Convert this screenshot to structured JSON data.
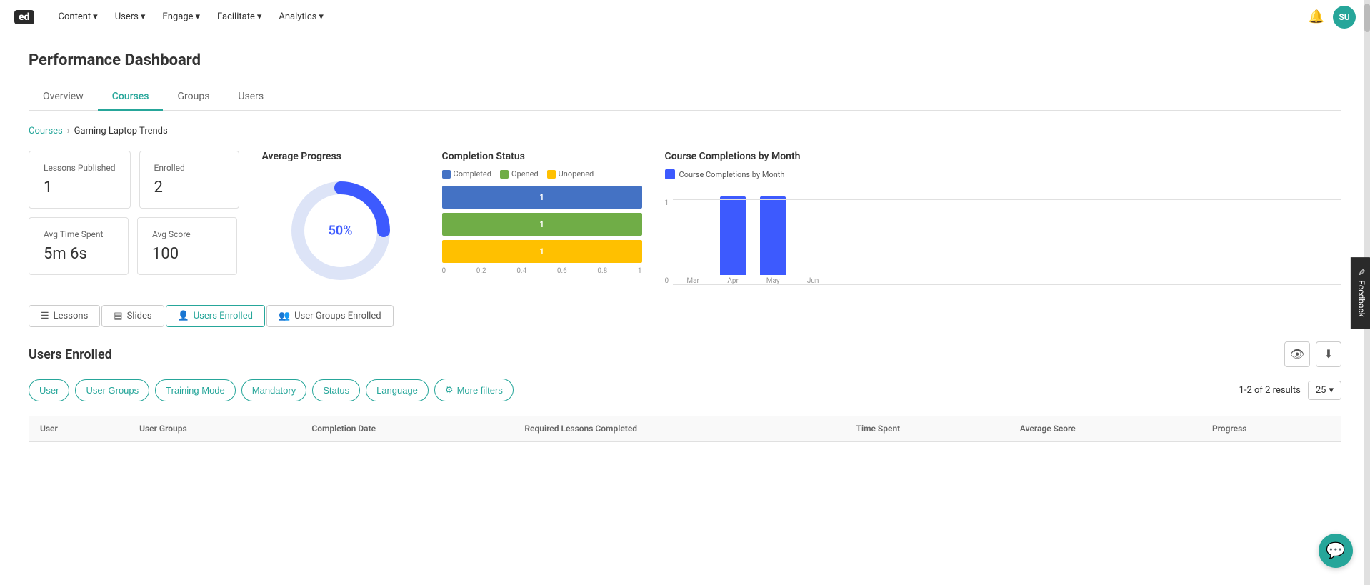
{
  "nav": {
    "logo": "ed",
    "items": [
      "Content",
      "Users",
      "Engage",
      "Facilitate",
      "Analytics"
    ],
    "avatar": "SU"
  },
  "page": {
    "title": "Performance Dashboard"
  },
  "tabs": {
    "items": [
      "Overview",
      "Courses",
      "Groups",
      "Users"
    ],
    "active": "Courses"
  },
  "breadcrumb": {
    "parent": "Courses",
    "current": "Gaming Laptop Trends"
  },
  "stats": [
    {
      "label": "Lessons Published",
      "value": "1"
    },
    {
      "label": "Enrolled",
      "value": "2"
    },
    {
      "label": "Avg Time Spent",
      "value": "5m 6s"
    },
    {
      "label": "Avg Score",
      "value": "100"
    }
  ],
  "avg_progress": {
    "title": "Average Progress",
    "percent": "50%",
    "value": 50
  },
  "completion_status": {
    "title": "Completion Status",
    "legend": [
      {
        "label": "Completed",
        "color": "#4472c4"
      },
      {
        "label": "Opened",
        "color": "#70ad47"
      },
      {
        "label": "Unopened",
        "color": "#ffc000"
      }
    ],
    "bars": [
      {
        "label": "Completed",
        "value": 1,
        "color": "#4472c4",
        "percent": 100
      },
      {
        "label": "Opened",
        "value": 1,
        "color": "#70ad47",
        "percent": 100
      },
      {
        "label": "Unopened",
        "value": 1,
        "color": "#ffc000",
        "percent": 100
      }
    ],
    "x_axis": [
      "0",
      "0.2",
      "0.4",
      "0.6",
      "0.8",
      "1"
    ]
  },
  "course_completions": {
    "title": "Course Completions by Month",
    "legend_label": "Course Completions by Month",
    "y_labels": [
      "1",
      "0"
    ],
    "bars": [
      {
        "month": "Mar",
        "value": 0
      },
      {
        "month": "Apr",
        "value": 1
      },
      {
        "month": "May",
        "value": 1
      },
      {
        "month": "Jun",
        "value": 0
      }
    ]
  },
  "sub_tabs": {
    "items": [
      "Lessons",
      "Slides",
      "Users Enrolled",
      "User Groups Enrolled"
    ],
    "active": "Users Enrolled"
  },
  "users_enrolled": {
    "section_title": "Users Enrolled",
    "filters": [
      "User",
      "User Groups",
      "Training Mode",
      "Mandatory",
      "Status",
      "Language",
      "More filters"
    ],
    "results_text": "1-2 of 2 results",
    "page_size": "25",
    "table": {
      "headers": [
        "User",
        "User Groups",
        "Completion Date",
        "Required Lessons Completed",
        "Time Spent",
        "Average Score",
        "Progress"
      ],
      "rows": []
    }
  },
  "feedback": {
    "label": "Feedback"
  }
}
